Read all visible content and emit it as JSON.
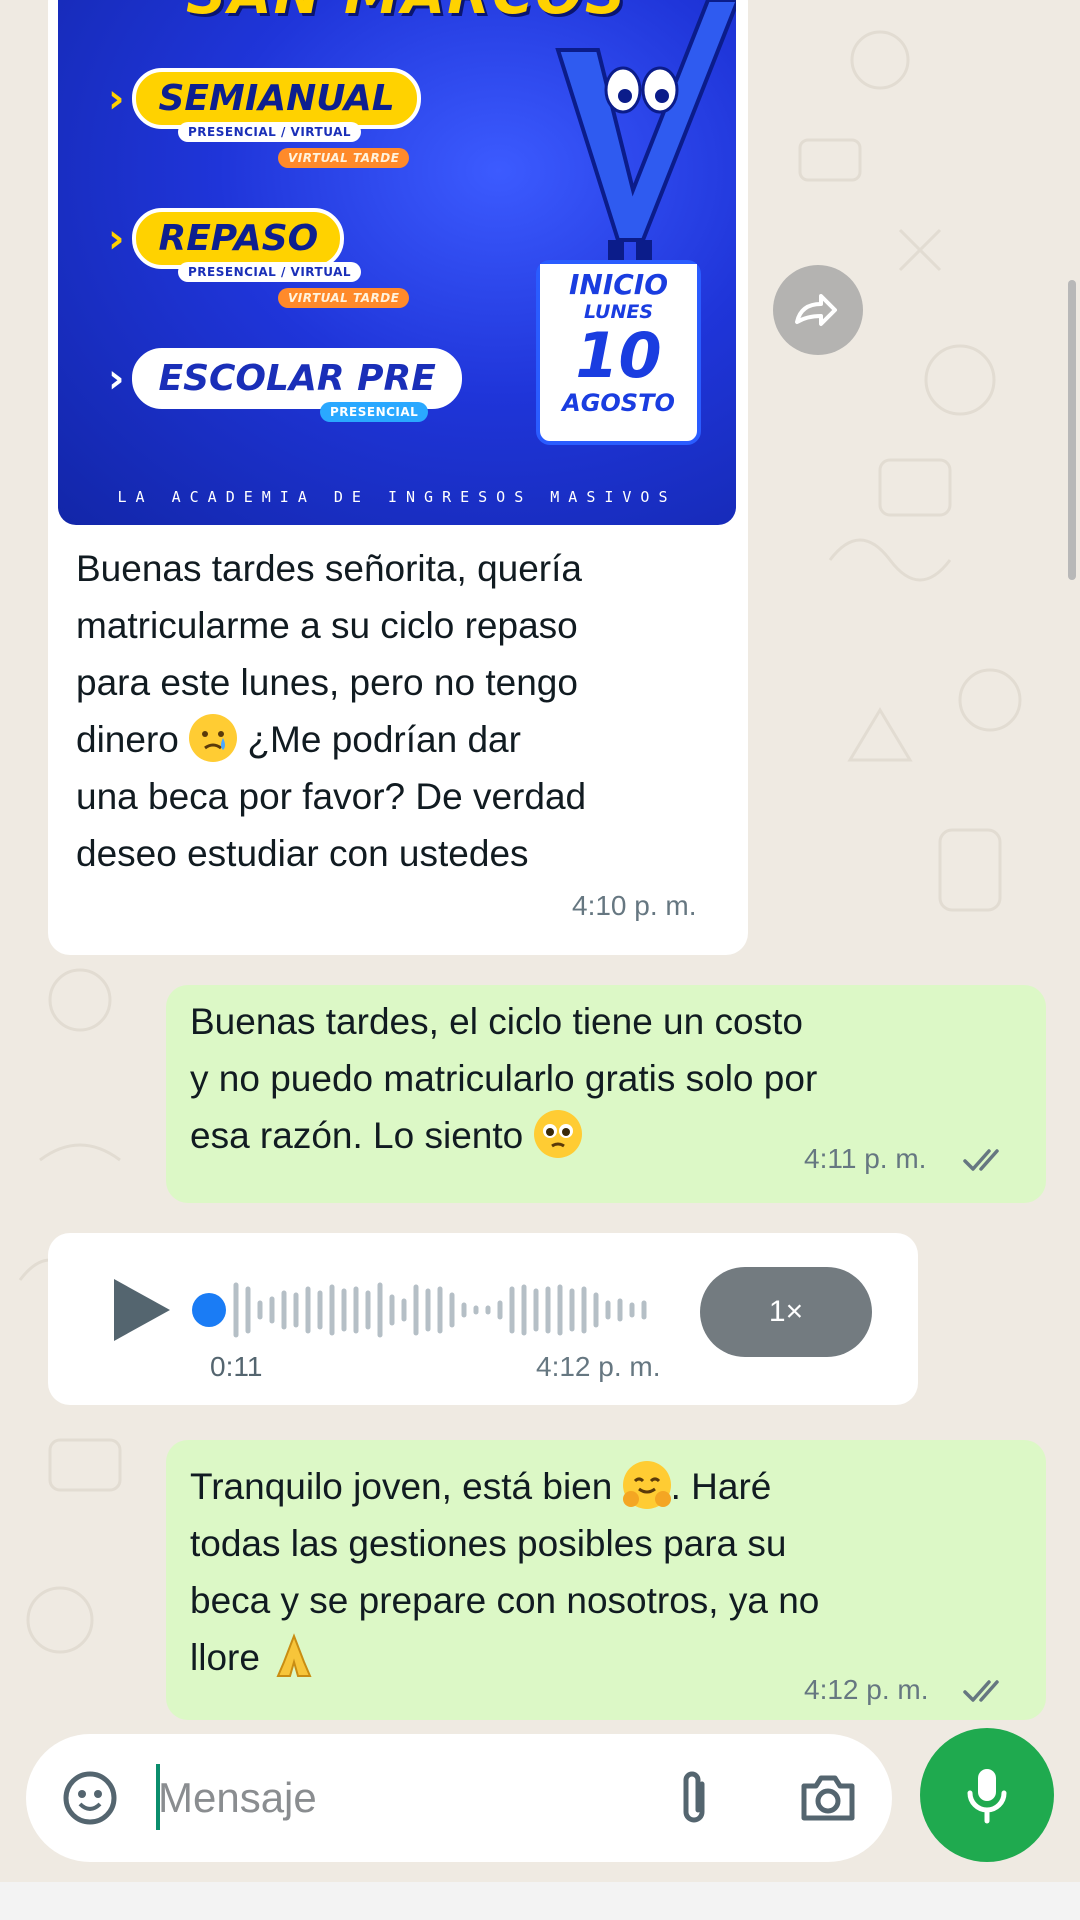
{
  "poster": {
    "title": "SAN MARCOS",
    "programs": [
      {
        "name": "SEMIANUAL",
        "modes": "PRESENCIAL / VIRTUAL",
        "extra": "VIRTUAL TARDE"
      },
      {
        "name": "REPASO",
        "modes": "PRESENCIAL / VIRTUAL",
        "extra": "VIRTUAL TARDE"
      },
      {
        "name": "ESCOLAR PRE",
        "modes": "PRESENCIAL"
      }
    ],
    "inicio": {
      "label": "INICIO",
      "day": "LUNES",
      "number": "10",
      "month": "AGOSTO"
    },
    "tagline": "LA ACADEMIA DE INGRESOS MASIVOS"
  },
  "messages": [
    {
      "direction": "in",
      "text_parts": [
        "Buenas tardes señorita, quería",
        "matricularme a su ciclo repaso",
        "para este lunes, pero no tengo",
        "dinero",
        "¿Me podrían dar",
        "una beca por favor? De verdad",
        "deseo estudiar con ustedes"
      ],
      "emoji": "crying-face",
      "time": "4:10 p. m."
    },
    {
      "direction": "out",
      "text_parts": [
        "Buenas tardes, el ciclo tiene un costo",
        "y no puedo matricularlo gratis solo por",
        "esa razón. Lo siento"
      ],
      "emoji": "pleading-face",
      "time": "4:11 p. m.",
      "status": "read"
    },
    {
      "direction": "in",
      "type": "voice",
      "duration": "0:11",
      "time": "4:12 p. m.",
      "speed": "1×",
      "progress": 0
    },
    {
      "direction": "out",
      "text_parts": [
        "Tranquilo joven, está bien",
        ". Haré",
        "todas las gestiones posibles para su",
        "beca y se prepare con nosotros, ya no",
        "llore"
      ],
      "emojis": [
        "hugging-face",
        "folded-hands"
      ],
      "time": "4:12 p. m.",
      "status": "read"
    }
  ],
  "composer": {
    "placeholder": "Mensaje",
    "icons": [
      "sticker-icon",
      "attach-icon",
      "camera-icon",
      "mic-icon"
    ]
  },
  "colors": {
    "outgoing_bubble": "#dcf8c6",
    "incoming_bubble": "#ffffff",
    "chat_background": "#efeae2",
    "mic_button": "#1faa4f",
    "read_ticks": "#667781"
  }
}
